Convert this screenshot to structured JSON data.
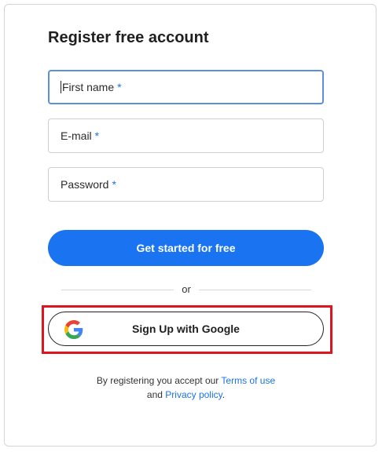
{
  "form": {
    "title": "Register free account",
    "fields": [
      {
        "label": "First name",
        "required": "*"
      },
      {
        "label": "E-mail",
        "required": "*"
      },
      {
        "label": "Password",
        "required": "*"
      }
    ],
    "submit_label": "Get started for free",
    "divider_text": "or",
    "google_label": "Sign Up with Google",
    "google_icon": "google-g-icon"
  },
  "footer": {
    "text1": "By registering you accept our",
    "terms_link": "Terms of use",
    "text2": "and",
    "privacy_link": "Privacy policy",
    "end": "."
  },
  "colors": {
    "accent": "#1a73f0",
    "link": "#1a73e8",
    "highlight": "#e0141e"
  }
}
